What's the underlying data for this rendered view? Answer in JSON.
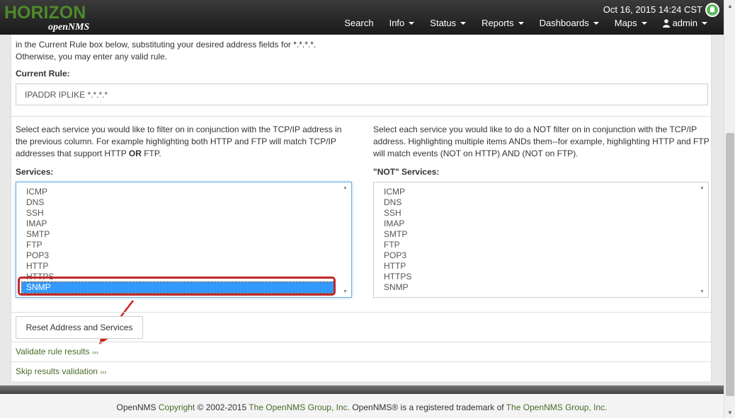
{
  "header": {
    "logo_horizon": "HORIZON",
    "logo_opennms": "openNMS",
    "datetime": "Oct 16, 2015 14:24 CST",
    "nav": [
      {
        "label": "Search",
        "dropdown": false
      },
      {
        "label": "Info",
        "dropdown": true
      },
      {
        "label": "Status",
        "dropdown": true
      },
      {
        "label": "Reports",
        "dropdown": true
      },
      {
        "label": "Dashboards",
        "dropdown": true
      },
      {
        "label": "Maps",
        "dropdown": true
      },
      {
        "label": "admin",
        "dropdown": true,
        "icon": "user-icon"
      }
    ]
  },
  "rule": {
    "intro_line1": "in the Current Rule box below, substituting your desired address fields for *.*.*.*.",
    "intro_line2": "Otherwise, you may enter any valid rule.",
    "current_rule_label": "Current Rule:",
    "current_rule_value": "IPADDR IPLIKE *.*.*.*"
  },
  "services": {
    "left_desc_1": "Select each service you would like to filter on in conjunction with the TCP/IP address in the previous column. For example highlighting both HTTP and FTP will match TCP/IP addresses that support HTTP ",
    "left_desc_or": "OR",
    "left_desc_2": " FTP.",
    "right_desc": "Select each service you would like to do a NOT filter on in conjunction with the TCP/IP address. Highlighting multiple items ANDs them--for example, highlighting HTTP and FTP will match events (NOT on HTTP) AND (NOT on FTP).",
    "left_label": "Services:",
    "right_label": "\"NOT\" Services:",
    "left_items": [
      "ICMP",
      "DNS",
      "SSH",
      "IMAP",
      "SMTP",
      "FTP",
      "POP3",
      "HTTP",
      "HTTPS",
      "SNMP"
    ],
    "left_selected": "SNMP",
    "right_items": [
      "ICMP",
      "DNS",
      "SSH",
      "IMAP",
      "SMTP",
      "FTP",
      "POP3",
      "HTTP",
      "HTTPS",
      "SNMP"
    ]
  },
  "actions": {
    "reset_label": "Reset Address and Services",
    "validate_label": "Validate rule results",
    "skip_label": "Skip results validation",
    "chevrons": "›››"
  },
  "footer": {
    "part1": "OpenNMS ",
    "part2": "Copyright",
    "part3": " © 2002-2015 ",
    "part4": "The OpenNMS Group, Inc.",
    "part5": " OpenNMS® is a registered trademark of ",
    "part6": "The OpenNMS Group, Inc."
  },
  "colors": {
    "highlight": "#c0282d",
    "selection": "#3399ff",
    "link": "#4a6a2a",
    "brand_green": "#4d8a2a"
  }
}
